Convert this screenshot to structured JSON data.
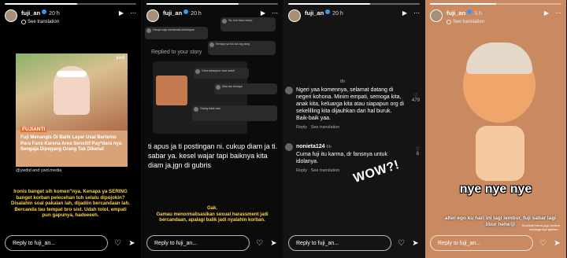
{
  "colors": {
    "accent": "#ffd24a",
    "verified": "#3897f0",
    "reply_border": "#ffffff"
  },
  "panels": [
    {
      "username": "fuji_an",
      "time": "20 h",
      "translate": "See translation",
      "header_icons": [
        "play-icon",
        "more-icon"
      ],
      "card": {
        "brand": "ywd",
        "name_tag": "FUJIANTI",
        "caption": "Fuji Menangis Di Balik Layar Usai Bertemu Para Fans Karena Area Sensitif Pay*dara nya Sengaja Dipegang Orang Tak Dikenal"
      },
      "credit": "@ywdid and ywd.media",
      "text": "Ironis banget sih komen\"nya. Kenapa ya SERING banget korban pelecehan tuh selalu dipojokin? Disalahin soal pakaian lah, dijadiin bercandaan lah. Bercanda tau tempat bro sist. Udah tolol, empati pun gapunya, hadeeeeh.",
      "reply_placeholder": "Reply to fuji_an..."
    },
    {
      "username": "fuji_an",
      "time": "20 h",
      "replied_label": "Replied to your story",
      "big_text": "ti apus ja ti postingan ni. cukup diam ja ti.\nsabar ya. kesel wajar tapi baiknya kita diam ja.jgn di gubris",
      "text": "Gak.\nGamau menormalisasikan sexual harassment jadi bercandaan, apalagi balik jadi nyalahin korban.",
      "reply_placeholder": "Reply to fuji_an...",
      "mini_comments": [
        "Hanya saja menikmati kehidupan",
        "Sa, kok bisa mcmp",
        "Kenapa ya klo ad org yang",
        "Cara walaupun rasa salah",
        "Mau tau kenapa",
        "Orang tidak ada"
      ]
    },
    {
      "username": "fuji_an",
      "time": "20 h",
      "comments": [
        {
          "time": "8h",
          "text": "Ngeri yaa komennya, selamat datang di negeri kohona. Minim empati, semoga kita, anak kita, keluarga kita atau siapapun org di sekelilling kita dijauhkan dari hal buruk. Baik-baik yaa.",
          "reply": "Reply",
          "see": "See translation",
          "likes": "479"
        },
        {
          "user": "nonieta124",
          "time": "6h",
          "text": "Cuma fuji itu karma, dr fansnya untuk idolanya.",
          "reply": "Reply",
          "see": "See translation",
          "likes": "8"
        }
      ],
      "sticker": "WOW?!",
      "reply_placeholder": "Reply to fuji_an..."
    },
    {
      "username": "fuji_an",
      "time": "3 h",
      "translate": "See translation",
      "meme": "nye nye nye",
      "text": "alter ego ku hari ini lagi lembur, fuji sabar lagi libur hehe😁",
      "small_text": "Sesekali harus jugo lembur\nmenjaga tapi gabisa...",
      "reply_placeholder": "Reply to fuji_an..."
    }
  ],
  "progress": [
    0.55,
    0.7,
    0.62,
    0.5
  ]
}
